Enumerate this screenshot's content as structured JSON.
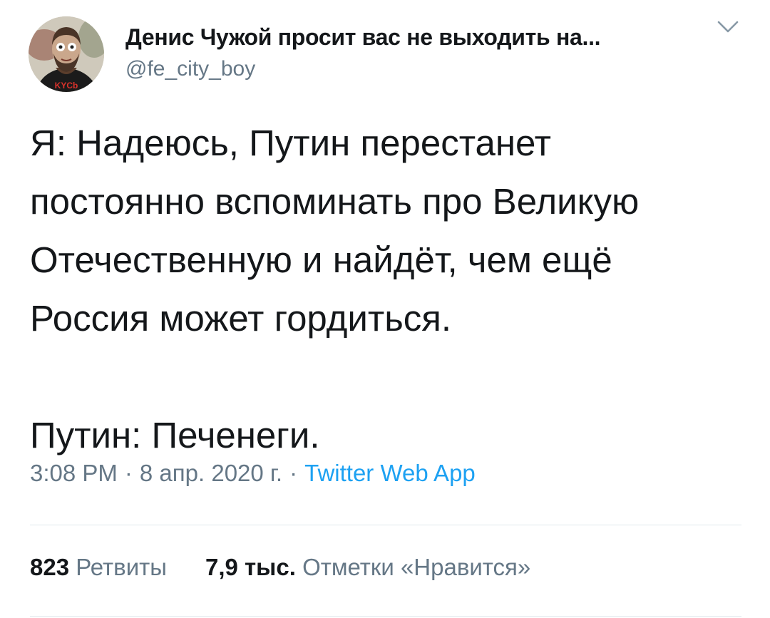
{
  "author": {
    "display_name": "Денис Чужой просит вас не выходить на...",
    "handle": "@fe_city_boy",
    "avatar_shirt_text": "KYCb"
  },
  "tweet": {
    "text": "Я: Надеюсь, Путин перестанет\nпостоянно вспоминать про Великую\nОтечественную и найдёт, чем ещё\nРоссия может гордиться.\n\nПутин: Печенеги."
  },
  "meta": {
    "time": "3:08 PM",
    "separator": "·",
    "date": "8 апр. 2020 г.",
    "source": "Twitter Web App"
  },
  "stats": {
    "retweets_count": "823",
    "retweets_label": "Ретвиты",
    "likes_count": "7,9 тыс.",
    "likes_label": "Отметки «Нравится»"
  },
  "colors": {
    "text": "#14171a",
    "secondary": "#657786",
    "link": "#1da1f2",
    "divider": "#e1e8ed"
  }
}
